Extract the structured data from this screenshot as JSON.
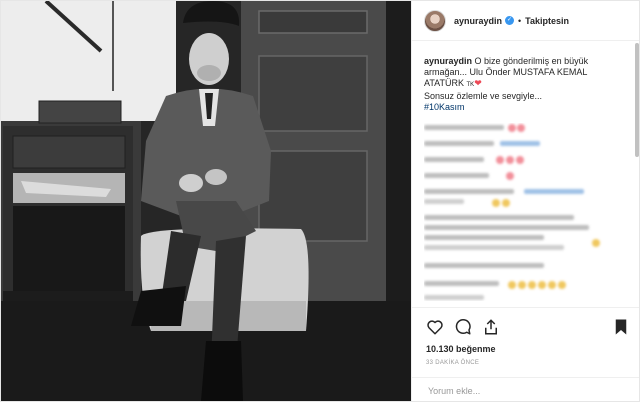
{
  "post": {
    "username": "aynuraydin",
    "follow_label": "Takiptesin",
    "separator": "•",
    "caption": {
      "username": "aynuraydin",
      "line1": "O bize gönderilmiş en büyük armağan... Ulu Önder MUSTAFA KEMAL ATATÜRK",
      "tk_mark": "TK",
      "line2": "Sonsuz özlemle ve sevgiyle...",
      "hashtag": "#10Kasım"
    },
    "likes": "10.130 beğenme",
    "timestamp": "33 DAKİKA ÖNCE",
    "comment_placeholder": "Yorum ekle..."
  },
  "icons": {
    "verified": "verified-badge-icon",
    "like": "heart-icon",
    "comment": "comment-icon",
    "share": "share-icon",
    "save": "bookmark-icon"
  },
  "colors": {
    "hashtag": "#003569",
    "verified": "#3897f0",
    "heart": "#ed4956"
  }
}
